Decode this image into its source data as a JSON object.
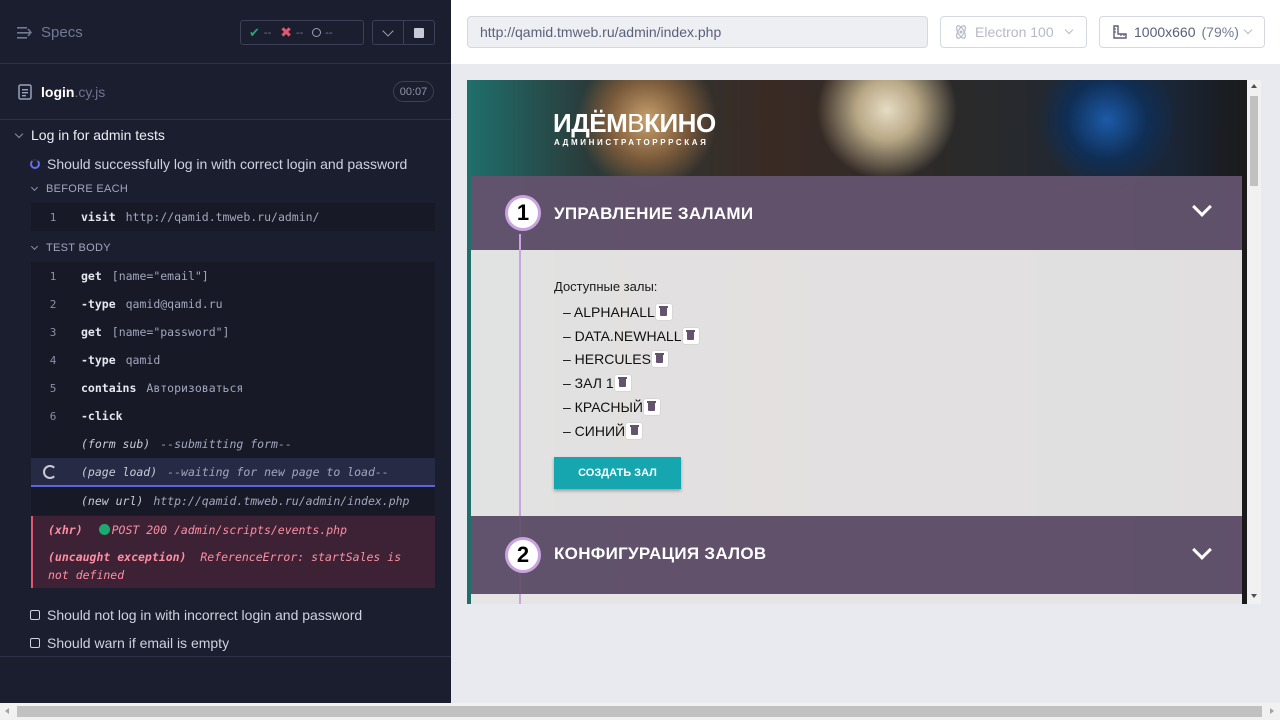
{
  "reporter": {
    "specs_label": "Specs",
    "stats": {
      "passed": "--",
      "failed": "--",
      "pending": "--"
    },
    "spec_file": {
      "name": "login",
      "ext": ".cy.js",
      "duration": "00:07"
    },
    "suite_title": "Log in for admin tests",
    "active_test": "Should successfully log in with correct login and password",
    "before_each_label": "BEFORE EACH",
    "test_body_label": "TEST BODY",
    "before_each_commands": [
      {
        "num": "1",
        "name": "visit",
        "message": "http://qamid.tmweb.ru/admin/"
      }
    ],
    "body_commands": [
      {
        "num": "1",
        "name": "get",
        "message": "[name=\"email\"]"
      },
      {
        "num": "2",
        "name": "-type",
        "message": "qamid@qamid.ru"
      },
      {
        "num": "3",
        "name": "get",
        "message": "[name=\"password\"]"
      },
      {
        "num": "4",
        "name": "-type",
        "message": "qamid"
      },
      {
        "num": "5",
        "name": "contains",
        "message": "Авторизоваться"
      },
      {
        "num": "6",
        "name": "-click",
        "message": ""
      }
    ],
    "form_sub": {
      "name": "(form sub)",
      "message": "--submitting form--"
    },
    "page_load": {
      "name": "(page load)",
      "message": "--waiting for new page to load--"
    },
    "new_url": {
      "name": "(new url)",
      "message": "http://qamid.tmweb.ru/admin/index.php"
    },
    "xhr": {
      "name": "(xhr)",
      "message": "POST 200 /admin/scripts/events.php"
    },
    "exception": {
      "name": "(uncaught exception)",
      "message": "ReferenceError: startSales is",
      "message2": "not defined"
    },
    "other_tests": [
      "Should not log in with incorrect login and password",
      "Should warn if email is empty"
    ]
  },
  "aut": {
    "url": "http://qamid.tmweb.ru/admin/index.php",
    "browser": "Electron 100",
    "viewport": "1000x660",
    "zoom": "(79%)"
  },
  "site": {
    "logo_main": "ИДЁМ",
    "logo_mid": "В",
    "logo_end": "КИНО",
    "logo_sub": "АДМИНИСТРАТОРРРСКАЯ",
    "section1": {
      "num": "1",
      "title": "УПРАВЛЕНИЕ ЗАЛАМИ"
    },
    "section2": {
      "num": "2",
      "title": "КОНФИГУРАЦИЯ ЗАЛОВ"
    },
    "halls_label": "Доступные залы:",
    "halls": [
      "– ALPHAHALL",
      "– DATA.NEWHALL",
      "– HERCULES",
      "– ЗАЛ 1",
      "– КРАСНЫЙ",
      "– СИНИЙ"
    ],
    "create_button": "СОЗДАТЬ ЗАЛ"
  },
  "colors": {
    "accent": "#6470f3",
    "pass": "#1fa971",
    "fail": "#e45770",
    "site_section": "#63536d",
    "site_button": "#16a6af"
  }
}
